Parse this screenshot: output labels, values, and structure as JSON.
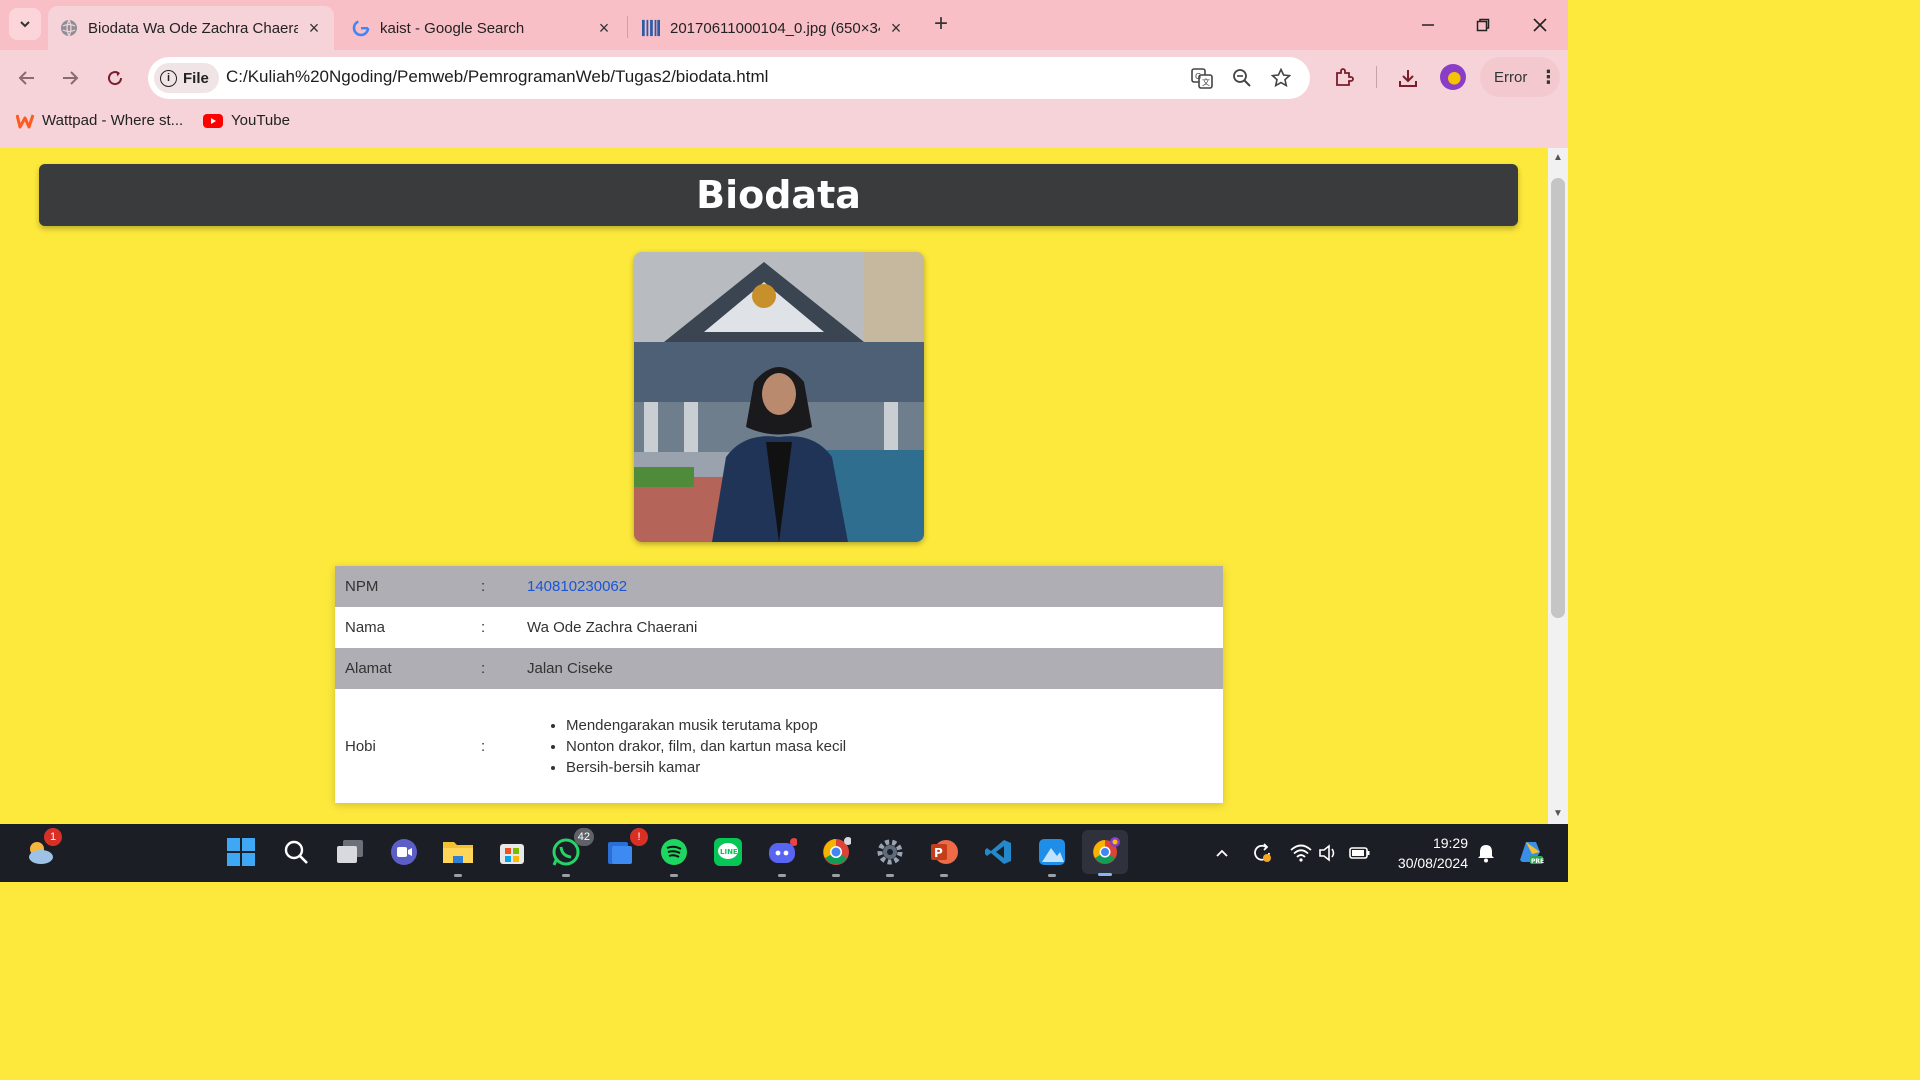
{
  "browser": {
    "tabs": [
      {
        "title": "Biodata Wa Ode Zachra Chaerani",
        "active": true,
        "favicon": "globe-icon"
      },
      {
        "title": "kaist - Google Search",
        "active": false,
        "favicon": "google-g-icon"
      },
      {
        "title": "20170611000104_0.jpg (650×34",
        "active": false,
        "favicon": "image-icon"
      }
    ],
    "file_chip": "File",
    "url": "C:/Kuliah%20Ngoding/Pemweb/PemrogramanWeb/Tugas2/biodata.html",
    "error_label": "Error",
    "bookmarks": [
      {
        "label": "Wattpad - Where st...",
        "icon": "wattpad-icon"
      },
      {
        "label": "YouTube",
        "icon": "youtube-icon"
      }
    ]
  },
  "page": {
    "title": "Biodata",
    "photo_alt": "Profile photo",
    "rows": [
      {
        "label": "NPM",
        "colon": ":",
        "value": "140810230062"
      },
      {
        "label": "Nama",
        "colon": ":",
        "value": "Wa Ode Zachra Chaerani"
      },
      {
        "label": "Alamat",
        "colon": ":",
        "value": "Jalan Ciseke"
      },
      {
        "label": "Hobi",
        "colon": ":"
      }
    ],
    "hobbies": [
      "Mendengarakan musik terutama kpop",
      "Nonton drakor, film, dan kartun masa kecil",
      "Bersih-bersih kamar"
    ],
    "colors": {
      "background": "#fde93b",
      "header": "#3a3b3c",
      "row_alt": "#aeaeb4",
      "link": "#1a55d8"
    }
  },
  "taskbar": {
    "weather_badge": "1",
    "whatsapp_badge": "42",
    "store_badge": "!",
    "time": "19:29",
    "date": "30/08/2024"
  }
}
